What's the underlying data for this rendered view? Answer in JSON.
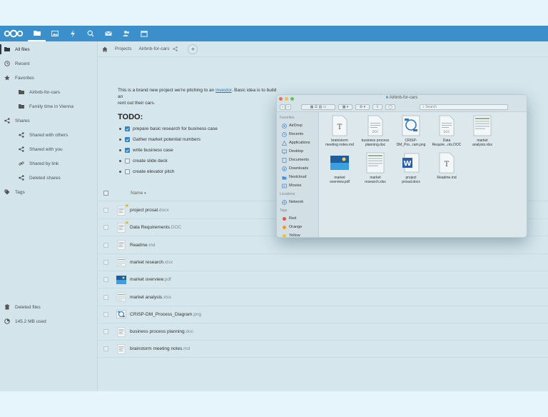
{
  "topbar": {
    "apps": [
      {
        "name": "files-icon",
        "active": true
      },
      {
        "name": "photos-icon",
        "active": false
      },
      {
        "name": "activity-icon",
        "active": false
      },
      {
        "name": "search-icon",
        "active": false
      },
      {
        "name": "mail-icon",
        "active": false
      },
      {
        "name": "contacts-icon",
        "active": false
      },
      {
        "name": "calendar-icon",
        "active": false
      }
    ],
    "accent": "#3b8fcb"
  },
  "sidebar": {
    "all_files": "All files",
    "recent": "Recent",
    "favorites": "Favorites",
    "fav_1": "Airbnb-for-cars",
    "fav_2": "Family time in Vienna",
    "shares": "Shares",
    "shared_with_others": "Shared with others",
    "shared_with_you": "Shared with you",
    "shared_by_link": "Shared by link",
    "deleted_shares": "Deleted shares",
    "tags": "Tags",
    "deleted_files": "Deleted files",
    "quota": "145.2 MB used"
  },
  "breadcrumb": {
    "home": "home-icon",
    "level1": "Projects",
    "level2": "Airbnb-for-cars"
  },
  "readme": {
    "intro_before": "This is a brand new project we're pitching to an ",
    "intro_link": "investor",
    "intro_after": ". Basic idea is to build an",
    "intro_line2": "rent out their cars.",
    "todo_title": "TODO:",
    "todos": [
      {
        "text": "prepare basic research for business case",
        "checked": true
      },
      {
        "text": "Gather market potential numbers",
        "checked": true
      },
      {
        "text": "write business case",
        "checked": true
      },
      {
        "text": "create slide deck",
        "checked": false
      },
      {
        "text": "create elevator pitch",
        "checked": false
      }
    ]
  },
  "file_list": {
    "name_header": "Name",
    "files": [
      {
        "base": "project prosal",
        "ext": ".docx",
        "favorite": true
      },
      {
        "base": "Data Requirements",
        "ext": ".DOC",
        "favorite": true
      },
      {
        "base": "Readme",
        "ext": ".md",
        "favorite": false
      },
      {
        "base": "market research",
        "ext": ".xlsx",
        "favorite": false
      },
      {
        "base": "market overview",
        "ext": ".pdf",
        "favorite": false
      },
      {
        "base": "market analysis",
        "ext": ".xlsx",
        "favorite": false
      },
      {
        "base": "CRISP-DM_Process_Diagram",
        "ext": ".png",
        "favorite": false
      },
      {
        "base": "business process planning",
        "ext": ".doc",
        "favorite": false
      },
      {
        "base": "brainstorm meeting notes",
        "ext": ".md",
        "favorite": false
      }
    ]
  },
  "finder": {
    "title": "Airbnb-for-cars",
    "search_placeholder": "Search",
    "favorites_label": "Favorites",
    "favorites": [
      "AirDrop",
      "Recents",
      "Applications",
      "Desktop",
      "Documents",
      "Downloads",
      "Nextcloud",
      "Movies"
    ],
    "locations_label": "Locations",
    "locations": [
      "Network"
    ],
    "tags_label": "Tags",
    "tags": [
      {
        "name": "Red",
        "color": "#e0524b"
      },
      {
        "name": "Orange",
        "color": "#f09a2d"
      },
      {
        "name": "Yellow",
        "color": "#e8c52b"
      }
    ],
    "files": [
      {
        "line1": "brainstorm",
        "line2": "meeting notes.md"
      },
      {
        "line1": "business process",
        "line2": "planning.doc"
      },
      {
        "line1": "CRISP-",
        "line2": "DM_Pro...ram.png"
      },
      {
        "line1": "Data",
        "line2": "Require...nts.DOC"
      },
      {
        "line1": "market",
        "line2": "analysis.xlsx"
      },
      {
        "line1": "market",
        "line2": "overview.pdf"
      },
      {
        "line1": "market",
        "line2": "research.xlsx"
      },
      {
        "line1": "project",
        "line2": "prosal.docx"
      },
      {
        "line1": "Readme.md",
        "line2": ""
      }
    ]
  }
}
